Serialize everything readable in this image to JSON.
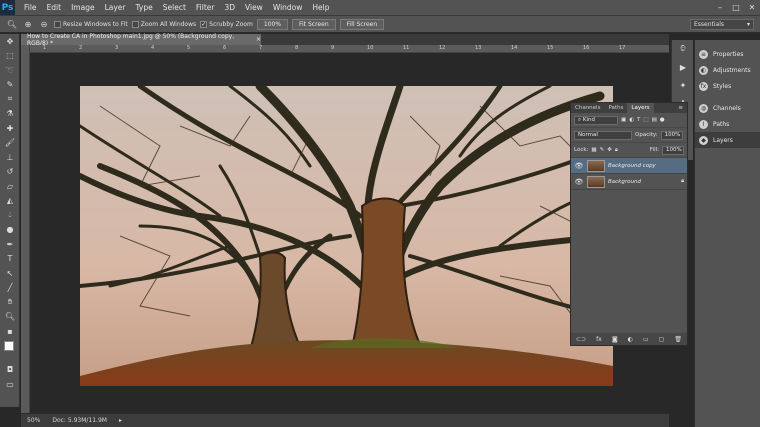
{
  "app": {
    "logo": "Ps"
  },
  "menu": [
    "File",
    "Edit",
    "Image",
    "Layer",
    "Type",
    "Select",
    "Filter",
    "3D",
    "View",
    "Window",
    "Help"
  ],
  "window_controls": {
    "minimize": "–",
    "maximize": "□",
    "close": "✕"
  },
  "options": {
    "resize_windows_to_fit": "Resize Windows to Fit",
    "zoom_all_windows": "Zoom All Windows",
    "scrubby_zoom": "Scrubby Zoom",
    "zoom_100": "100%",
    "fit_screen": "Fit Screen",
    "fill_screen": "Fill Screen",
    "workspace": "Essentials"
  },
  "document": {
    "tab_title": "How to Create CA in Photoshop main1.jpg @ 50% (Background copy, RGB/8) *",
    "close": "×"
  },
  "ruler_ticks": [
    "1",
    "2",
    "3",
    "4",
    "5",
    "6",
    "7",
    "8",
    "9",
    "10",
    "11",
    "12",
    "13",
    "14",
    "15",
    "16",
    "17"
  ],
  "status": {
    "zoom": "50%",
    "doc": "Doc: 5.93M/11.9M"
  },
  "right_dock": {
    "items": [
      {
        "label": "Properties"
      },
      {
        "label": "Adjustments"
      },
      {
        "label": "Styles"
      },
      {
        "label": "Channels"
      },
      {
        "label": "Paths"
      },
      {
        "label": "Layers"
      }
    ]
  },
  "layers_panel": {
    "tabs": [
      "Channels",
      "Paths",
      "Layers"
    ],
    "kind": "Kind",
    "blend_mode": "Normal",
    "opacity_label": "Opacity:",
    "opacity": "100%",
    "lock_label": "Lock:",
    "fill_label": "Fill:",
    "fill": "100%",
    "layers": [
      {
        "name": "Background copy",
        "selected": true
      },
      {
        "name": "Background",
        "selected": false
      }
    ]
  }
}
